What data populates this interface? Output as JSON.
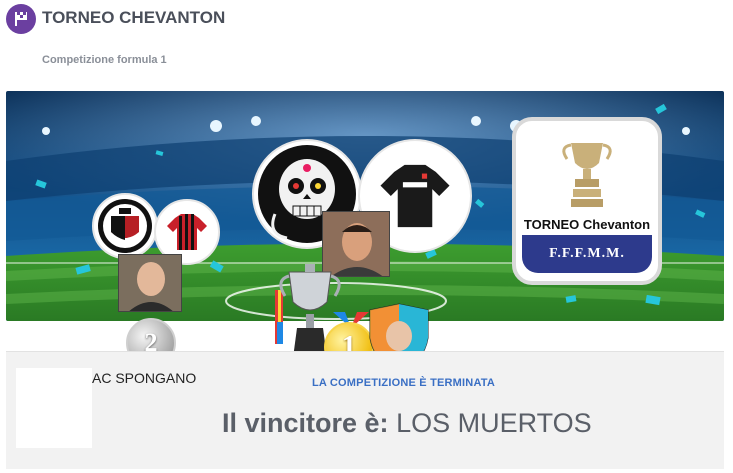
{
  "header": {
    "title": "TORNEO CHEVANTON",
    "subtitle": "Competizione formula 1"
  },
  "trophy_card": {
    "name": "TORNEO Chevanton",
    "badge": "F.F.F.M.M."
  },
  "podium": {
    "second": {
      "medal": "2",
      "team": "AC SPONGANO"
    },
    "first": {
      "medal": "1"
    }
  },
  "result": {
    "status": "LA COMPETIZIONE È TERMINATA",
    "winner_label": "Il vincitore è:",
    "winner_name": "LOS MUERTOS"
  },
  "colors": {
    "brand": "#6b3fa0",
    "status": "#3a6fc4",
    "pitch": "#2f8a2a",
    "stands": "#0e3a6a",
    "badge": "#2d3a8c"
  }
}
